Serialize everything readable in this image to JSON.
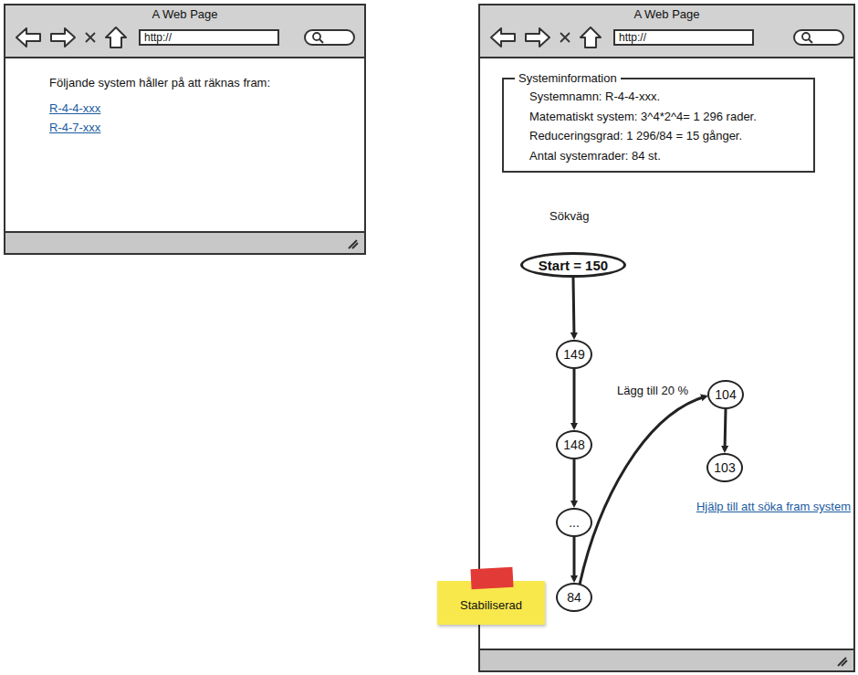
{
  "windows": [
    {
      "title": "A Web Page",
      "url": "http://",
      "heading": "Följande system håller på att räknas fram:",
      "links": [
        "R-4-4-xxx",
        "R-4-7-xxx"
      ]
    },
    {
      "title": "A Web Page",
      "url": "http://",
      "info": {
        "legend": "Systeminformation",
        "lines": [
          "Systemnamn: R-4-4-xxx.",
          "Matematiskt system: 3^4*2^4= 1 296 rader.",
          "Reduceringsgrad:  1 296/84 = 15 gånger.",
          "Antal systemrader: 84 st."
        ]
      },
      "path_label": "Sökväg"
    }
  ],
  "diagram": {
    "nodes": [
      {
        "label": "Start = 150",
        "kind": "start"
      },
      {
        "label": "149",
        "kind": "node"
      },
      {
        "label": "148",
        "kind": "node"
      },
      {
        "label": "...",
        "kind": "node"
      },
      {
        "label": "84",
        "kind": "node"
      },
      {
        "label": "104",
        "kind": "node"
      },
      {
        "label": "103",
        "kind": "node"
      }
    ],
    "edges": [
      {
        "from": 0,
        "to": 1
      },
      {
        "from": 1,
        "to": 2
      },
      {
        "from": 2,
        "to": 3
      },
      {
        "from": 3,
        "to": 4
      },
      {
        "from": 4,
        "to": 5,
        "label": "Lägg till 20 %"
      },
      {
        "from": 5,
        "to": 6
      }
    ],
    "note": "Stabiliserad",
    "help_link": "Hjälp till att söka fram system"
  }
}
